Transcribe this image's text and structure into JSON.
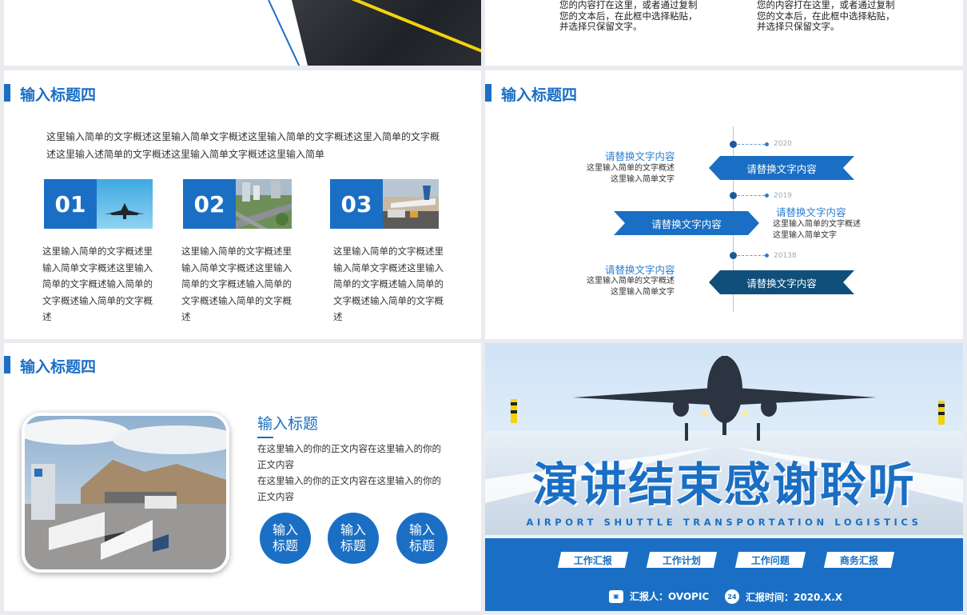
{
  "top_right": {
    "col1": "您的内容打在这里，或者通过复制\n您的文本后，在此框中选择粘贴，\n并选择只保留文字。",
    "col2": "您的内容打在这里，或者通过复制\n您的文本后，在此框中选择粘贴，\n并选择只保留文字。"
  },
  "slide_a": {
    "title": "输入标题四",
    "intro": "这里输入简单的文字概述这里输入简单文字概述这里输入简单的文字概述这里入简单的文字概述这里输入述简单的文字概述这里输入简单文字概述这里输入简单",
    "cards": [
      {
        "num": "01",
        "desc": "这里输入简单的文字概述里输入简单文字概述这里输入简单的文字概述输入简单的文字概述输入简单的文字概述"
      },
      {
        "num": "02",
        "desc": "这里输入简单的文字概述里输入简单文字概述这里输入简单的文字概述输入简单的文字概述输入简单的文字概述"
      },
      {
        "num": "03",
        "desc": "这里输入简单的文字概述里输入简单文字概述这里输入简单的文字概述输入简单的文字概述输入简单的文字概述"
      }
    ]
  },
  "slide_b": {
    "title": "输入标题四",
    "items": [
      {
        "year": "2020",
        "head": "请替换文字内容",
        "sub": "这里输入简单的文字概述\n这里输入简单文字",
        "ribbon": "请替换文字内容"
      },
      {
        "year": "2019",
        "head": "请替换文字内容",
        "sub": "这里输入简单的文字概述\n这里输入简单文字",
        "ribbon": "请替换文字内容"
      },
      {
        "year": "20138",
        "head": "请替换文字内容",
        "sub": "这里输入简单的文字概述\n这里输入简单文字",
        "ribbon": "请替换文字内容"
      }
    ]
  },
  "slide_c": {
    "title": "输入标题四",
    "subtitle": "输入标题",
    "body": "在这里输入的你的正文内容在这里输入的你的正文内容\n在这里输入的你的正文内容在这里输入的你的正文内容",
    "buttons": [
      "输入\n标题",
      "输入\n标题",
      "输入\n标题"
    ]
  },
  "end_slide": {
    "title": "演讲结束感谢聆听",
    "subtitle_en": "AIRPORT SHUTTLE TRANSPORTATION LOGISTICS",
    "tags": [
      "工作汇报",
      "工作计划",
      "工作问题",
      "商务汇报"
    ],
    "reporter": "汇报人：OVOPIC",
    "report_time": "汇报时间：2020.X.X"
  },
  "colors": {
    "primary": "#1a6fc4",
    "dark_ribbon": "#0f4f7a",
    "accent_yellow": "#f1d20f"
  }
}
